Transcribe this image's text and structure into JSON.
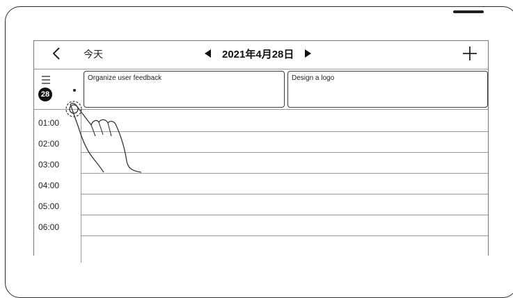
{
  "toolbar": {
    "back_icon": "chevron-left-icon",
    "today_label": "今天",
    "prev_icon": "triangle-left-icon",
    "date_title": "2021年4月28日",
    "next_icon": "triangle-right-icon",
    "add_icon": "plus-icon"
  },
  "sidebar": {
    "menu_icon": "menu-icon",
    "day_badge": "28"
  },
  "events": [
    {
      "title": "Organize user feedback"
    },
    {
      "title": "Design a logo"
    }
  ],
  "hours": [
    "01:00",
    "02:00",
    "03:00",
    "04:00",
    "05:00",
    "06:00"
  ],
  "gesture": {
    "icon": "tap-hand-icon"
  }
}
